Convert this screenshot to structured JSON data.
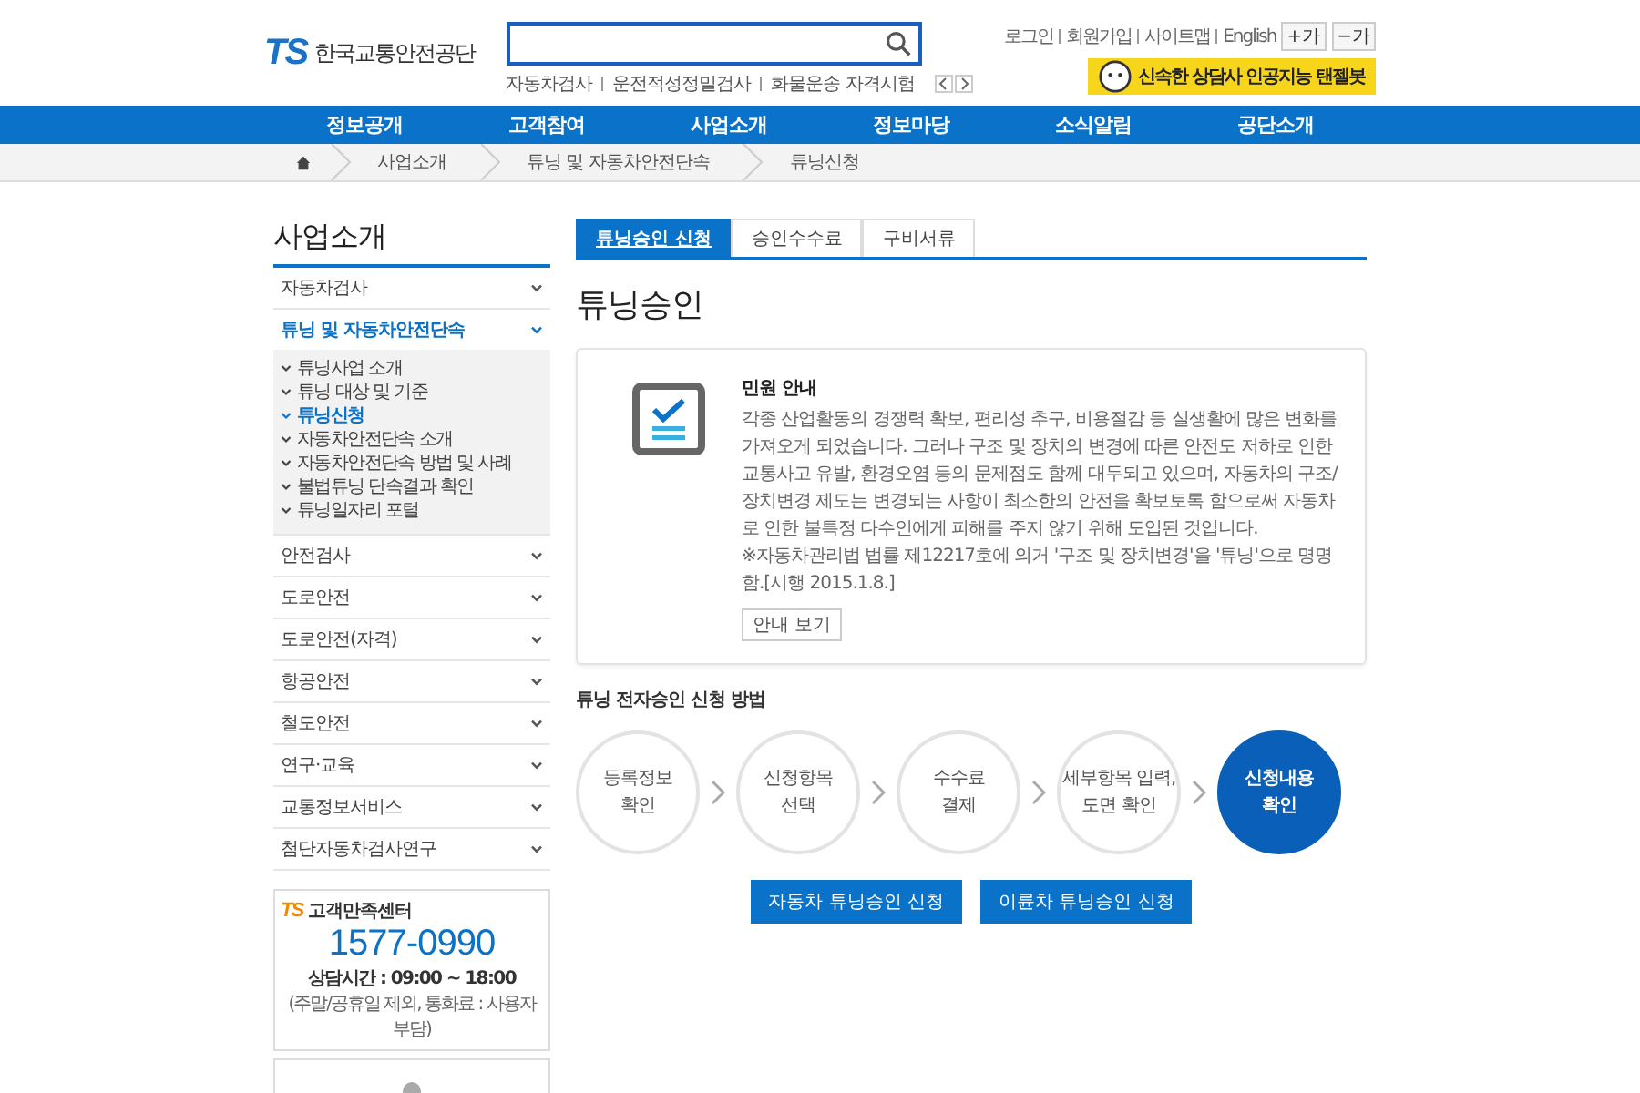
{
  "header": {
    "logo_mark": "TS",
    "logo_text": "한국교통안전공단",
    "quick_links": [
      "자동차검사",
      "운전적성정밀검사",
      "화물운송 자격시험"
    ],
    "util_links": [
      "로그인",
      "회원가입",
      "사이트맵",
      "English"
    ],
    "font_buttons": [
      "+가",
      "−가"
    ],
    "chatbot_banner": "신속한 상담사 인공지능 탠젤봇"
  },
  "nav": [
    "정보공개",
    "고객참여",
    "사업소개",
    "정보마당",
    "소식알림",
    "공단소개"
  ],
  "breadcrumb": [
    "사업소개",
    "튜닝 및 자동차안전단속",
    "튜닝신청"
  ],
  "sidebar": {
    "title": "사업소개",
    "items": [
      {
        "label": "자동차검사",
        "expanded": false
      },
      {
        "label": "튜닝 및 자동차안전단속",
        "expanded": true,
        "children": [
          {
            "label": "튜닝사업 소개",
            "selected": false
          },
          {
            "label": "튜닝 대상 및 기준",
            "selected": false
          },
          {
            "label": "튜닝신청",
            "selected": true
          },
          {
            "label": "자동차안전단속 소개",
            "selected": false
          },
          {
            "label": "자동차안전단속 방법 및 사례",
            "selected": false
          },
          {
            "label": "불법튜닝 단속결과 확인",
            "selected": false
          },
          {
            "label": "튜닝일자리 포털",
            "selected": false
          }
        ]
      },
      {
        "label": "안전검사",
        "expanded": false
      },
      {
        "label": "도로안전",
        "expanded": false
      },
      {
        "label": "도로안전(자격)",
        "expanded": false
      },
      {
        "label": "항공안전",
        "expanded": false
      },
      {
        "label": "철도안전",
        "expanded": false
      },
      {
        "label": "연구·교육",
        "expanded": false
      },
      {
        "label": "교통정보서비스",
        "expanded": false
      },
      {
        "label": "첨단자동차검사연구",
        "expanded": false
      }
    ],
    "contact": {
      "logo_mark": "TS",
      "title": "고객만족센터",
      "phone": "1577-0990",
      "hours": "상담시간 : 09:00 ~ 18:00",
      "note": "(주말/공휴일 제외, 통화료 : 사용자 부담)"
    }
  },
  "tabs": [
    {
      "label": "튜닝승인 신청",
      "selected": true
    },
    {
      "label": "승인수수료",
      "selected": false
    },
    {
      "label": "구비서류",
      "selected": false
    }
  ],
  "page_title": "튜닝승인",
  "notice": {
    "title": "민원 안내",
    "body": "각종 산업활동의 경쟁력 확보, 편리성 추구, 비용절감 등 실생활에 많은 변화를 가져오게 되었습니다. 그러나 구조 및 장치의 변경에 따른 안전도 저하로 인한 교통사고 유발, 환경오염 등의 문제점도 함께 대두되고 있으며, 자동차의 구조/장치변경 제도는 변경되는 사항이 최소한의 안전을 확보토록 함으로써 자동차로 인한 불특정 다수인에게 피해를 주지 않기 위해 도입된 것입니다.",
    "note": "※자동차관리법 법률 제12217호에 의거 '구조 및 장치변경'을 '튜닝'으로 명명함.[시행 2015.1.8.]",
    "button": "안내 보기"
  },
  "steps_title": "튜닝 전자승인 신청 방법",
  "steps": [
    {
      "label": "등록정보\n확인",
      "selected": false
    },
    {
      "label": "신청항목\n선택",
      "selected": false
    },
    {
      "label": "수수료\n결제",
      "selected": false
    },
    {
      "label": "세부항목 입력,\n도면 확인",
      "selected": false
    },
    {
      "label": "신청내용\n확인",
      "selected": true
    }
  ],
  "buttons": [
    "자동차 튜닝승인 신청",
    "이륜차 튜닝승인 신청"
  ]
}
